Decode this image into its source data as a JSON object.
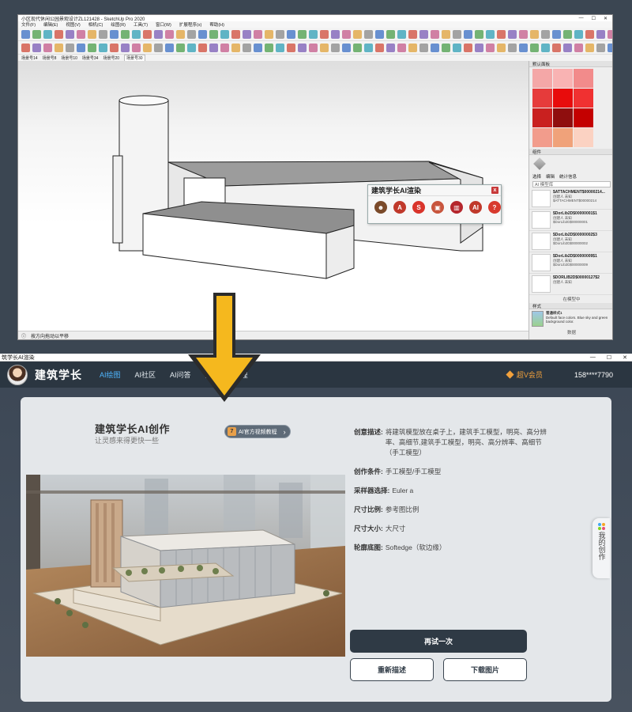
{
  "sketchup": {
    "window_title": "小区现代休闲公园景观设计ZL121428 - SketchUp Pro 2020",
    "window_buttons": [
      "—",
      "☐",
      "✕"
    ],
    "menu": [
      "文件(F)",
      "编辑(E)",
      "视图(V)",
      "相机(C)",
      "绘图(R)",
      "工具(T)",
      "窗口(W)",
      "扩展程序(x)",
      "帮助(H)"
    ],
    "scenes": [
      "场景号14",
      "场景号8",
      "场景号10",
      "场景号34",
      "场景号20",
      "场景号30"
    ],
    "active_scene_index": 5,
    "status_text": "按方向拖动以平移",
    "plugin_dialog": {
      "title": "建筑学长AI渲染",
      "close_label": "x",
      "icons": [
        {
          "name": "avatar-icon",
          "color": "#7a4a2a",
          "glyph": "☻"
        },
        {
          "name": "ai-render-icon",
          "color": "#c0392b",
          "glyph": "A"
        },
        {
          "name": "sketch-icon",
          "color": "#d9342b",
          "glyph": "S"
        },
        {
          "name": "image-icon",
          "color": "#c8553d",
          "glyph": "▣"
        },
        {
          "name": "book-icon",
          "color": "#b5262d",
          "glyph": "▥"
        },
        {
          "name": "ai-chat-icon",
          "color": "#c0392b",
          "glyph": "AI"
        },
        {
          "name": "help-icon",
          "color": "#d83a2e",
          "glyph": "?"
        }
      ]
    },
    "tray": {
      "materials_header": "默认面板",
      "swatches": [
        "#f4a7a7",
        "#f9b3b3",
        "#f28b8b",
        "#e63b3b",
        "#e80c0c",
        "#f03131",
        "#c9201f",
        "#8f0e0e",
        "#c40000",
        "#f29c8c",
        "#f0a27a",
        "#fbd2c2"
      ],
      "components_header": "组件",
      "tabs": [
        "选择",
        "编辑",
        "统计信息"
      ],
      "search_placeholder": "AI 模型库",
      "components": [
        {
          "name": "$ATTACHMENT$00000214...",
          "creator": "创建人 未知",
          "path": "$ATTACHMENT$00000214"
        },
        {
          "name": "$DorLib2D$00000001$1",
          "creator": "创建人 未知",
          "path": "$DorLib2D$00000001"
        },
        {
          "name": "$DorLib2D$00000002$3",
          "creator": "创建人 未知",
          "path": "$DorLib2D$00000002"
        },
        {
          "name": "$DorLib2D$00000009$1",
          "creator": "创建人 未知",
          "path": "$DorLib2D$00000009"
        },
        {
          "name": "$DORLIB2D$00000127$2",
          "creator": "创建人 未知",
          "path": ""
        }
      ],
      "in_model_label": "在模型中",
      "styles_header": "样式",
      "style_name": "普通样式1",
      "style_desc": "Default face colors. Blue sky and green background color.",
      "data_label": "数据"
    }
  },
  "web": {
    "window_title": "筑学长AI渲染",
    "window_buttons": [
      "—",
      "☐",
      "✕"
    ],
    "brand": "建筑学长",
    "nav": [
      {
        "label": "AI绘图",
        "active": true
      },
      {
        "label": "AI社区",
        "active": false
      },
      {
        "label": "AI问答",
        "active": false
      },
      {
        "label": "图库",
        "active": false
      },
      {
        "label": "课程",
        "active": false
      }
    ],
    "vip_label": "超V会员",
    "phone": "158****7790",
    "card": {
      "title": "建筑学长AI创作",
      "subtitle": "让灵感来得更快一些",
      "tutorial_icon": "7",
      "tutorial_label": "AI官方视频教程",
      "params": [
        {
          "key": "创意描述:",
          "value": "将建筑模型放在桌子上，建筑手工模型，明亮、高分辨率、高细节,建筑手工模型，明亮、高分辨率、高细节（手工模型）"
        },
        {
          "key": "创作条件:",
          "value": "手工模型/手工模型"
        },
        {
          "key": "采样器选择:",
          "value": "Euler a"
        },
        {
          "key": "尺寸比例:",
          "value": "参考图比例"
        },
        {
          "key": "尺寸大小:",
          "value": "大尺寸"
        },
        {
          "key": "轮廓底图:",
          "value": "Softedge（软边缘）"
        }
      ],
      "retry_label": "再试一次",
      "redescribe_label": "重新描述",
      "download_label": "下载图片"
    },
    "side_tab_label": "我的创作",
    "side_dots_colors": [
      "#3fa9f5",
      "#f5a623",
      "#7ed321",
      "#e94e77"
    ]
  },
  "colors": {
    "nav_bg": "#2b3641",
    "accent_blue": "#4fb6ff",
    "vip_orange": "#f2a13c",
    "arrow_yellow": "#f5b81e",
    "button_dark": "#2f3a45"
  }
}
